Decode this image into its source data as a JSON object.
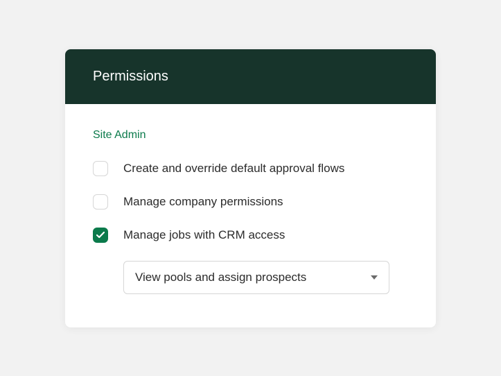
{
  "header": {
    "title": "Permissions"
  },
  "section": {
    "title": "Site Admin"
  },
  "permissions": [
    {
      "label": "Create and override default approval flows",
      "checked": false
    },
    {
      "label": "Manage company permissions",
      "checked": false
    },
    {
      "label": "Manage jobs with CRM access",
      "checked": true
    }
  ],
  "crm_select": {
    "value": "View pools and assign prospects"
  }
}
